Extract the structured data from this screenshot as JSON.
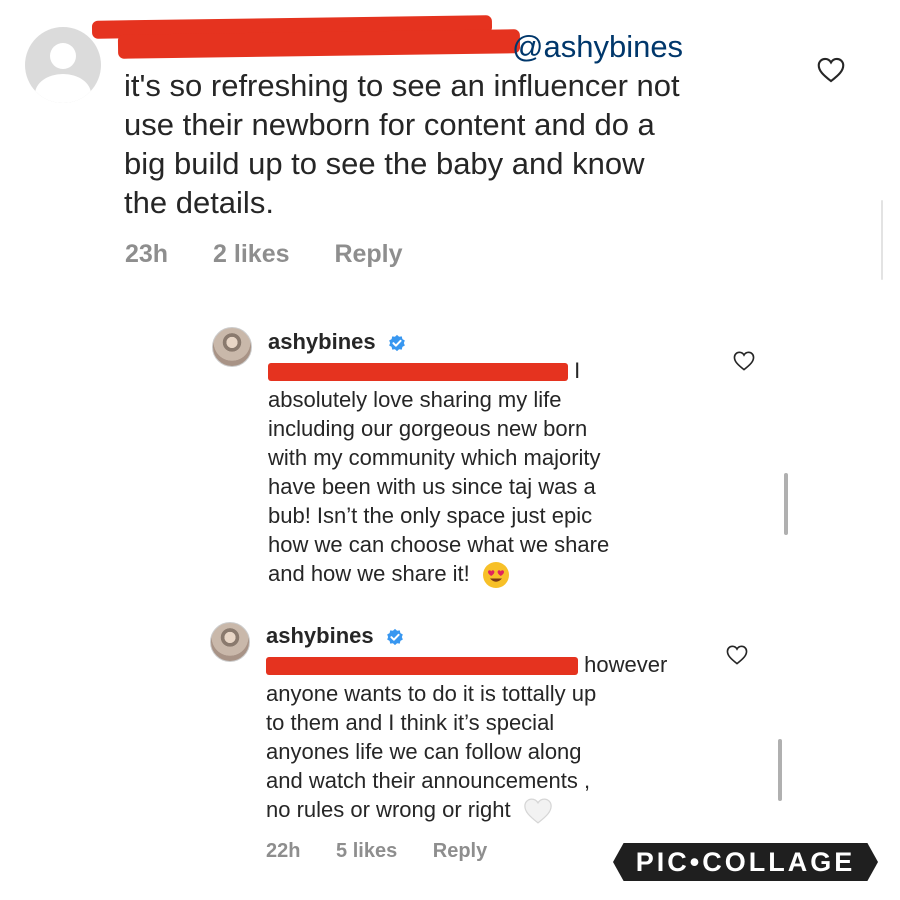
{
  "comment1": {
    "mention": "@ashybines",
    "lines": [
      "it's so refreshing to see an influencer not",
      "use their newborn for content and do a",
      "big build up to see the baby and know",
      "the details."
    ],
    "meta": {
      "time": "23h",
      "likes": "2 likes",
      "reply": "Reply"
    }
  },
  "reply1": {
    "username": "ashybines",
    "first_line_tail": "I",
    "lines": [
      "absolutely love sharing my life",
      "including our gorgeous new born",
      "with my community which majority",
      "have been with us since taj was a",
      "bub! Isn’t the only space just epic",
      "how we can choose what we share",
      "and how we share it!"
    ]
  },
  "reply2": {
    "username": "ashybines",
    "first_line_tail": "however",
    "lines": [
      "anyone wants to do it is tottally up",
      "to them and I think it’s special",
      "anyones life we can follow along",
      "and watch their announcements ,",
      "no rules or wrong or right"
    ],
    "meta": {
      "time": "22h",
      "likes": "5 likes",
      "reply": "Reply"
    }
  },
  "watermark": "PIC•COLLAGE",
  "icons": {
    "like": "heart-outline-icon",
    "verified": "verified-badge-icon",
    "heart_eyes": "heart-eyes-emoji",
    "white_heart": "white-heart-emoji"
  },
  "colors": {
    "redaction": "#e5331f",
    "verified": "#3897f0",
    "meta": "#8e8e8e",
    "mention": "#00376b"
  }
}
